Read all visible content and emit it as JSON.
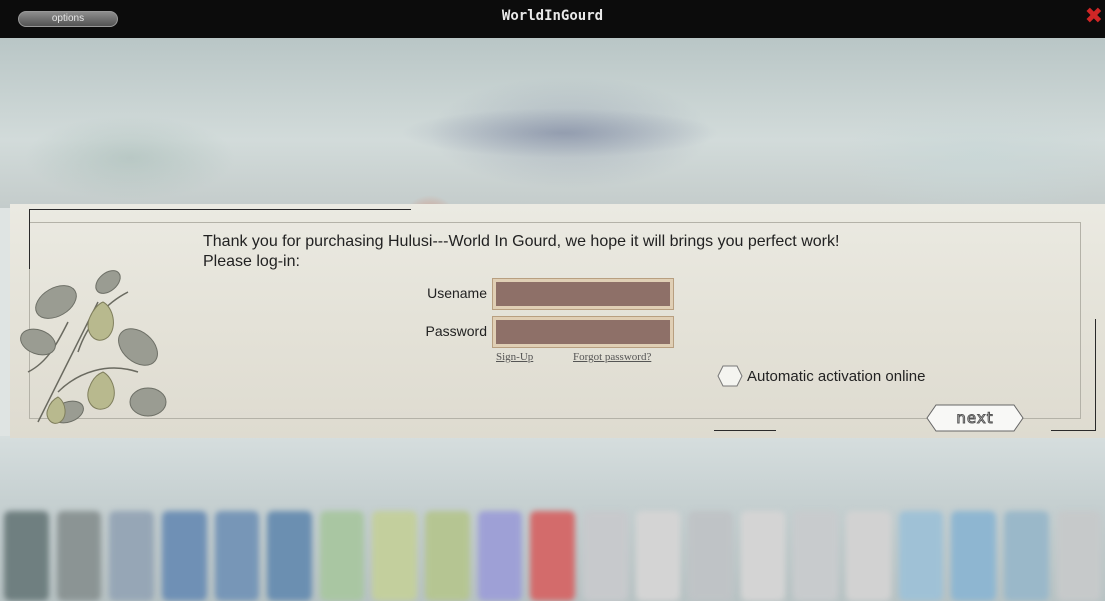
{
  "window": {
    "title": "WorldInGourd",
    "options_label": "options",
    "close_glyph": "✖"
  },
  "dialog": {
    "intro_line1": "Thank you for purchasing Hulusi---World In Gourd, we hope it will brings you perfect work!",
    "intro_line2": "Please log-in:",
    "username_label": "Usename",
    "username_value": "",
    "password_label": "Password",
    "password_value": "",
    "signup_link": "Sign-Up",
    "forgot_link": "Forgot password?",
    "auto_activation_label": "Automatic activation online",
    "auto_activation_checked": false,
    "next_label": "next"
  },
  "colors": {
    "titlebar": "#0c0c0c",
    "field_fill": "#8e7068",
    "close": "#d02626"
  },
  "keys_colors": [
    "#6f7f80",
    "#8b9494",
    "#96a6b6",
    "#6f90b5",
    "#7796b7",
    "#6b8fb1",
    "#a9c6a2",
    "#c3cf9d",
    "#b5c592",
    "#9ea0d6",
    "#d36b6b",
    "#c7c9cc",
    "#d4d4d4",
    "#bfc3c6",
    "#d4d4d4",
    "#c8cbcd",
    "#d2d2d2",
    "#9fc1d6",
    "#8eb6d1",
    "#9ab8c9",
    "#c6c9ca"
  ]
}
